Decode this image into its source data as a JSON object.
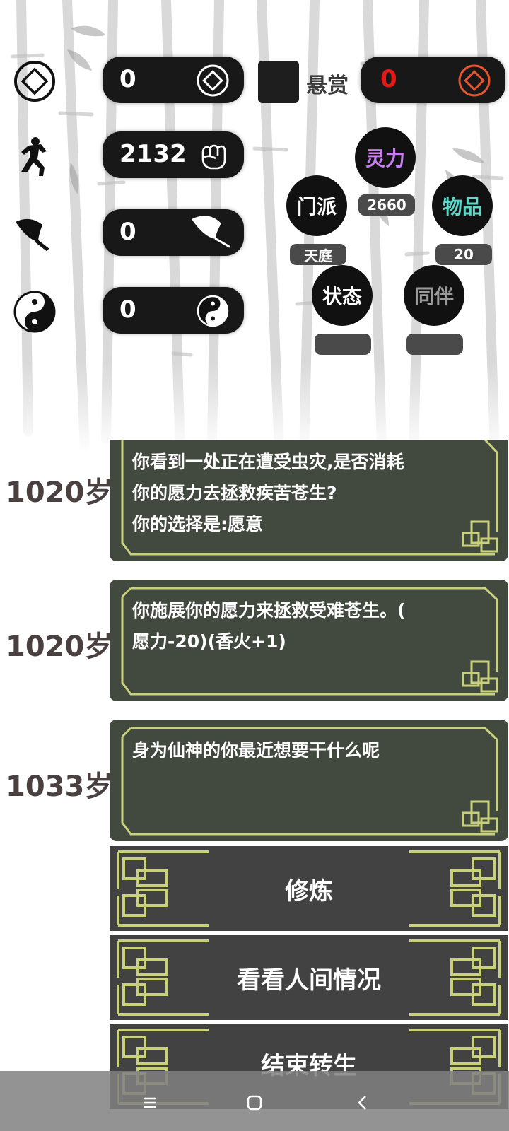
{
  "stats": {
    "currency": {
      "value": "0",
      "icon": "diamond-coin-icon"
    },
    "power": {
      "value": "2132",
      "icon": "fist-icon"
    },
    "faith": {
      "value": "0",
      "icon": "feather-fan-icon"
    },
    "taiji": {
      "value": "0",
      "icon": "yin-yang-icon"
    }
  },
  "bounty": {
    "label": "悬赏",
    "value": "0",
    "color": "#e51818"
  },
  "menu": {
    "spirit": {
      "label": "灵力",
      "badge": "2660",
      "color": "#c77df0"
    },
    "sect": {
      "label": "门派",
      "badge": "天庭"
    },
    "items": {
      "label": "物品",
      "badge": "20",
      "color": "#5fd6c8"
    },
    "status": {
      "label": "状态",
      "badge": ""
    },
    "companion": {
      "label": "同伴",
      "badge": "",
      "color": "#9a9a9a"
    }
  },
  "log": [
    {
      "age": "1020岁",
      "text": [
        "你看到一处正在遭受虫灾,是否消耗",
        "你的愿力去拯救疾苦苍生?",
        "你的选择是:愿意"
      ]
    },
    {
      "age": "1020岁",
      "text": [
        "你施展你的愿力来拯救受难苍生。(",
        "愿力-20)(香火+1)"
      ]
    },
    {
      "age": "1033岁",
      "text": [
        "身为仙神的你最近想要干什么呢"
      ]
    }
  ],
  "choices": [
    "修炼",
    "看看人间情况",
    "结束转生"
  ],
  "colors": {
    "accent_frame": "#c9d27a",
    "log_bg": "#424a40",
    "choice_bg": "#424242"
  }
}
